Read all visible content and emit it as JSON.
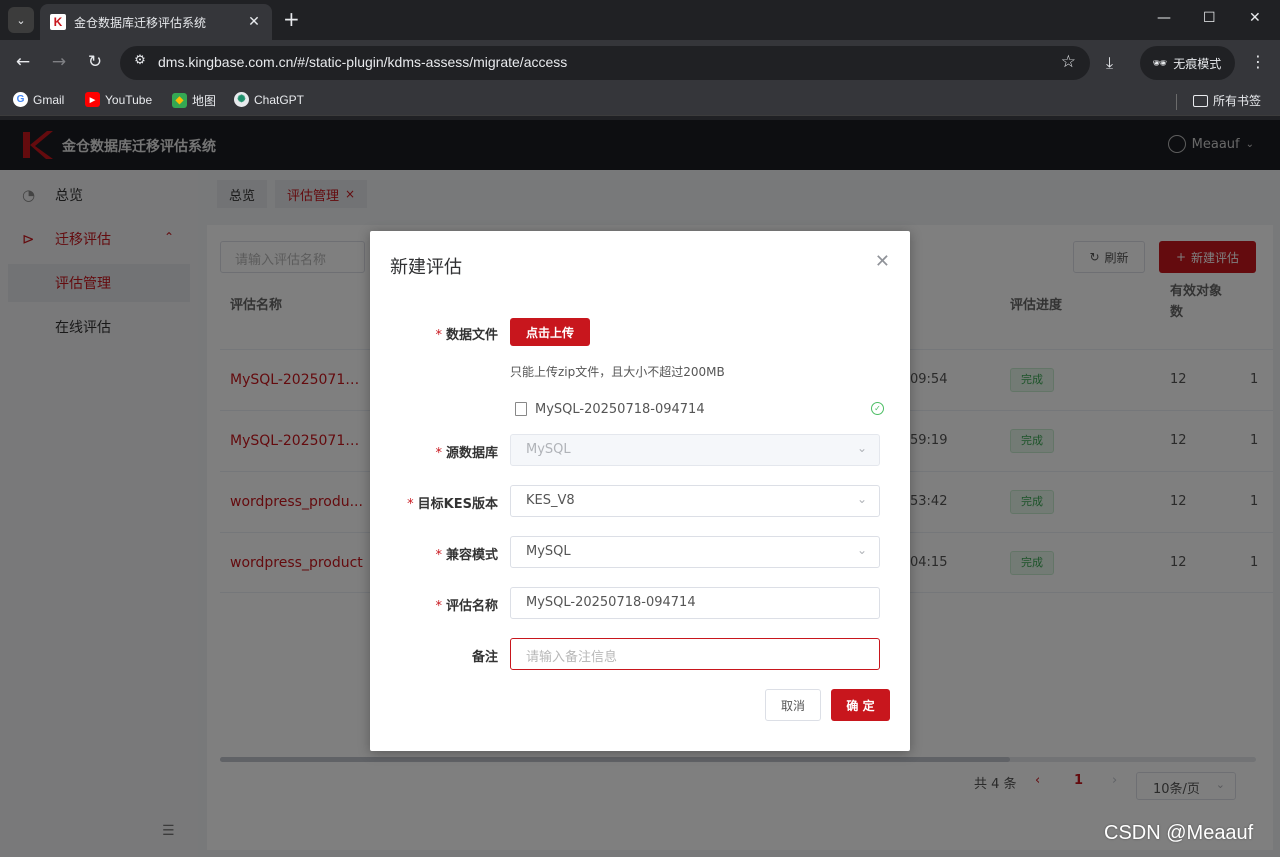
{
  "browser": {
    "tab_title": "金仓数据库迁移评估系统",
    "url": "dms.kingbase.com.cn/#/static-plugin/kdms-assess/migrate/access",
    "incognito_label": "无痕模式",
    "bookmarks": [
      "Gmail",
      "YouTube",
      "地图",
      "ChatGPT"
    ],
    "all_bookmarks": "所有书签"
  },
  "app": {
    "title": "金仓数据库迁移评估系统",
    "user": "Meaauf",
    "brand_color": "#c8161d"
  },
  "sidebar": {
    "items": [
      {
        "label": "总览",
        "icon": "dashboard-icon"
      },
      {
        "label": "迁移评估",
        "icon": "send-icon"
      },
      {
        "label": "评估管理"
      },
      {
        "label": "在线评估"
      }
    ]
  },
  "tags": [
    {
      "label": "总览"
    },
    {
      "label": "评估管理",
      "close": "×"
    }
  ],
  "toolbar": {
    "search_placeholder": "请输入评估名称",
    "refresh": "刷新",
    "new": "新建评估"
  },
  "table": {
    "columns": [
      "评估名称",
      "评估进度",
      "有效对象数"
    ],
    "rows": [
      {
        "name": "MySQL-20250717...",
        "time": "09:54",
        "status": "完成",
        "count": "12",
        "extra": "1"
      },
      {
        "name": "MySQL-20250717...",
        "time": "59:19",
        "status": "完成",
        "count": "12",
        "extra": "1"
      },
      {
        "name": "wordpress_produ...",
        "time": "53:42",
        "status": "完成",
        "count": "12",
        "extra": "1"
      },
      {
        "name": "wordpress_product",
        "time": "04:15",
        "status": "完成",
        "count": "12",
        "extra": "1"
      }
    ]
  },
  "pagination": {
    "total": "共 4 条",
    "current": "1",
    "page_size": "10条/页"
  },
  "modal": {
    "title": "新建评估",
    "fields": {
      "file_label": "数据文件",
      "upload_button": "点击上传",
      "upload_tip": "只能上传zip文件，且大小不超过200MB",
      "uploaded_file": "MySQL-20250718-094714",
      "source_label": "源数据库",
      "source_value": "MySQL",
      "target_label": "目标KES版本",
      "target_value": "KES_V8",
      "compat_label": "兼容模式",
      "compat_value": "MySQL",
      "name_label": "评估名称",
      "name_value": "MySQL-20250718-094714",
      "remark_label": "备注",
      "remark_placeholder": "请输入备注信息"
    },
    "cancel": "取消",
    "confirm": "确 定"
  },
  "watermark": "CSDN @Meaauf"
}
